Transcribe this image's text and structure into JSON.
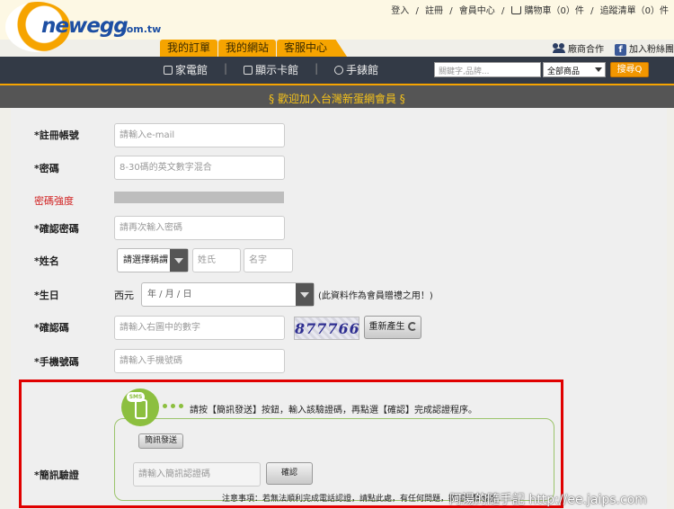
{
  "header": {
    "logo_text": "newegg",
    "logo_domain": ".com.tw",
    "top_links": [
      "登入",
      "註冊",
      "會員中心",
      "購物車（0）件",
      "追蹤清單（0）件"
    ],
    "separator": "/",
    "tabs": [
      "我的訂單",
      "我的網站",
      "客服中心"
    ],
    "social": {
      "vendor": "廠商合作",
      "facebook": "加入粉絲團",
      "fb_letter": "f"
    }
  },
  "nav": {
    "items": [
      "家電館",
      "顯示卡館",
      "手錶館"
    ],
    "search_placeholder": "關鍵字,品牌...",
    "category": "全部商品",
    "search_button": "搜尋Q"
  },
  "banner": {
    "text": "§ 歡迎加入台灣新蛋網會員 §"
  },
  "form": {
    "account": {
      "label": "*註冊帳號",
      "placeholder": "請輸入e-mail"
    },
    "password": {
      "label": "*密碼",
      "placeholder": "8-30碼的英文數字混合"
    },
    "strength": {
      "label": "密碼強度"
    },
    "confirm_password": {
      "label": "*確認密碼",
      "placeholder": "請再次輸入密碼"
    },
    "name": {
      "label": "*姓名",
      "title_select": "請選擇稱謂",
      "last_name": "姓氏",
      "first_name": "名字"
    },
    "birthday": {
      "label": "*生日",
      "era": "西元",
      "date_placeholder": "年 / 月 / 日",
      "note": "(此資料作為會員贈禮之用！)"
    },
    "captcha": {
      "label": "*確認碼",
      "placeholder": "請輸入右圖中的數字",
      "code": "877766",
      "refresh_label": "重新產生"
    },
    "mobile": {
      "label": "*手機號碼",
      "placeholder": "請輸入手機號碼"
    },
    "sms": {
      "label": "*簡訊驗證",
      "badge": "SMS",
      "instruction": "請按【簡訊發送】按鈕，輸入該驗證碼，再點選【確認】完成認證程序。",
      "send_button": "簡訊發送",
      "code_placeholder": "請輸入簡訊認證碼",
      "confirm_button": "確認",
      "note": "注意事項：若無法順利完成電話認證，請點此處，有任何問題，歡迎聯繫客服"
    }
  },
  "watermark": "阿湯的隨手記 http://ee.jaips.com",
  "colors": {
    "brand_orange": "#f6a400",
    "nav_dark": "#333a46",
    "highlight_red": "#e00000",
    "sms_green": "#8cbf3f"
  }
}
